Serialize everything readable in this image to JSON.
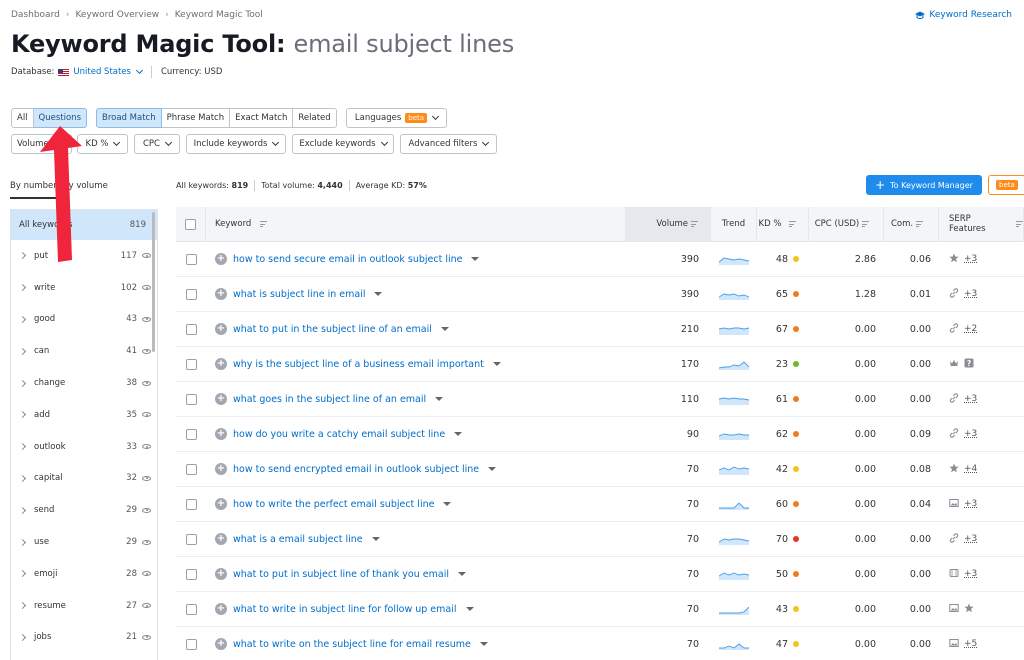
{
  "breadcrumb": [
    "Dashboard",
    "Keyword Overview",
    "Keyword Magic Tool"
  ],
  "header": {
    "title": "Keyword Magic Tool:",
    "query": "email subject lines",
    "keyword_research_link": "Keyword Research",
    "database_label": "Database:",
    "database_value": "United States",
    "currency": "Currency: USD"
  },
  "filters": {
    "type_tabs": [
      "All",
      "Questions"
    ],
    "match_tabs": [
      "Broad Match",
      "Phrase Match",
      "Exact Match",
      "Related"
    ],
    "languages": "Languages",
    "beta": "beta",
    "volume": "Volume",
    "kd": "KD %",
    "cpc": "CPC",
    "include": "Include keywords",
    "exclude": "Exclude keywords",
    "advanced": "Advanced filters"
  },
  "sidebar": {
    "tab_by_number": "By number",
    "tab_by_volume": "By volume",
    "tab_joiner": "y",
    "all_label": "All keywords",
    "all_count": "819",
    "items": [
      {
        "label": "put",
        "count": "117"
      },
      {
        "label": "write",
        "count": "102"
      },
      {
        "label": "good",
        "count": "43"
      },
      {
        "label": "can",
        "count": "41"
      },
      {
        "label": "change",
        "count": "38"
      },
      {
        "label": "add",
        "count": "35"
      },
      {
        "label": "outlook",
        "count": "33"
      },
      {
        "label": "capital",
        "count": "32"
      },
      {
        "label": "send",
        "count": "29"
      },
      {
        "label": "use",
        "count": "29"
      },
      {
        "label": "emoji",
        "count": "28"
      },
      {
        "label": "resume",
        "count": "27"
      },
      {
        "label": "jobs",
        "count": "21"
      }
    ]
  },
  "stats": {
    "all_keywords_label": "All keywords:",
    "all_keywords": "819",
    "total_volume_label": "Total volume:",
    "total_volume": "4,440",
    "avg_kd_label": "Average KD:",
    "avg_kd": "57%"
  },
  "to_keyword_manager": "To Keyword Manager",
  "table": {
    "headers": {
      "keyword": "Keyword",
      "volume": "Volume",
      "trend": "Trend",
      "kd": "KD %",
      "cpc": "CPC (USD)",
      "com": "Com.",
      "serp": "SERP Features"
    },
    "rows": [
      {
        "keyword": "how to send secure email in outlook subject line",
        "volume": "390",
        "kd": "48",
        "kd_color": "#f0c419",
        "cpc": "2.86",
        "com": "0.06",
        "serp_icons": [
          "star-icon"
        ],
        "serp_more": "+3"
      },
      {
        "keyword": "what is subject line in email",
        "volume": "390",
        "kd": "65",
        "kd_color": "#f07c1e",
        "cpc": "1.28",
        "com": "0.01",
        "serp_icons": [
          "link-icon"
        ],
        "serp_more": "+3"
      },
      {
        "keyword": "what to put in the subject line of an email",
        "volume": "210",
        "kd": "67",
        "kd_color": "#f07c1e",
        "cpc": "0.00",
        "com": "0.00",
        "serp_icons": [
          "link-icon"
        ],
        "serp_more": "+2"
      },
      {
        "keyword": "why is the subject line of a business email important",
        "volume": "170",
        "kd": "23",
        "kd_color": "#6cba2c",
        "cpc": "0.00",
        "com": "0.00",
        "serp_icons": [
          "crown-icon",
          "question-icon"
        ],
        "serp_more": ""
      },
      {
        "keyword": "what goes in the subject line of an email",
        "volume": "110",
        "kd": "61",
        "kd_color": "#f07c1e",
        "cpc": "0.00",
        "com": "0.00",
        "serp_icons": [
          "link-icon"
        ],
        "serp_more": "+3"
      },
      {
        "keyword": "how do you write a catchy email subject line",
        "volume": "90",
        "kd": "62",
        "kd_color": "#f07c1e",
        "cpc": "0.00",
        "com": "0.09",
        "serp_icons": [
          "link-icon"
        ],
        "serp_more": "+3"
      },
      {
        "keyword": "how to send encrypted email in outlook subject line",
        "volume": "70",
        "kd": "42",
        "kd_color": "#f0c419",
        "cpc": "0.00",
        "com": "0.08",
        "serp_icons": [
          "star-icon"
        ],
        "serp_more": "+4"
      },
      {
        "keyword": "how to write the perfect email subject line",
        "volume": "70",
        "kd": "60",
        "kd_color": "#f07c1e",
        "cpc": "0.00",
        "com": "0.04",
        "serp_icons": [
          "image-icon"
        ],
        "serp_more": "+3"
      },
      {
        "keyword": "what is a email subject line",
        "volume": "70",
        "kd": "70",
        "kd_color": "#e8352b",
        "cpc": "0.00",
        "com": "0.00",
        "serp_icons": [
          "link-icon"
        ],
        "serp_more": "+3"
      },
      {
        "keyword": "what to put in subject line of thank you email",
        "volume": "70",
        "kd": "50",
        "kd_color": "#f07c1e",
        "cpc": "0.00",
        "com": "0.00",
        "serp_icons": [
          "video-icon"
        ],
        "serp_more": "+3"
      },
      {
        "keyword": "what to write in subject line for follow up email",
        "volume": "70",
        "kd": "43",
        "kd_color": "#f0c419",
        "cpc": "0.00",
        "com": "0.00",
        "serp_icons": [
          "image-icon",
          "star-icon"
        ],
        "serp_more": ""
      },
      {
        "keyword": "what to write on the subject line for email resume",
        "volume": "70",
        "kd": "47",
        "kd_color": "#f0c419",
        "cpc": "0.00",
        "com": "0.00",
        "serp_icons": [
          "image-icon"
        ],
        "serp_more": "+5"
      }
    ]
  },
  "annotation": {
    "arrow_color": "#f0243a",
    "points_to": "Questions"
  }
}
